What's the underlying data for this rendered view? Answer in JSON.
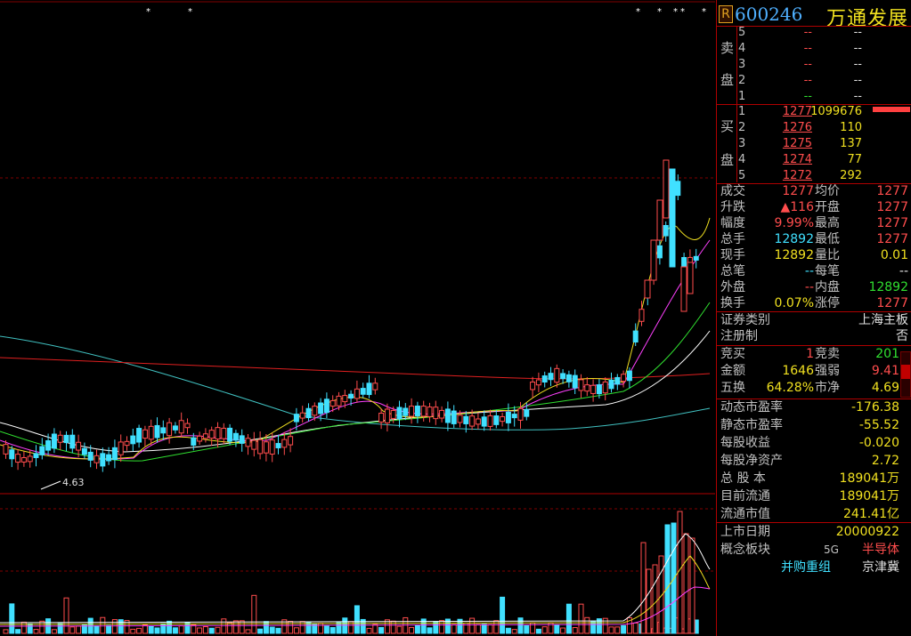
{
  "header": {
    "badge": "R",
    "code": "600246",
    "name": "万通发展"
  },
  "order_book": {
    "sell_label_1": "卖",
    "sell_label_2": "盘",
    "buy_label_1": "买",
    "buy_label_2": "盘",
    "sell": [
      {
        "level": "5",
        "price": "--",
        "volume": "--"
      },
      {
        "level": "4",
        "price": "--",
        "volume": "--"
      },
      {
        "level": "3",
        "price": "--",
        "volume": "--"
      },
      {
        "level": "2",
        "price": "--",
        "volume": "--"
      },
      {
        "level": "1",
        "price": "--",
        "volume": "--"
      }
    ],
    "buy": [
      {
        "level": "1",
        "price": "1277",
        "volume": "1099676"
      },
      {
        "level": "2",
        "price": "1276",
        "volume": "110"
      },
      {
        "level": "3",
        "price": "1275",
        "volume": "137"
      },
      {
        "level": "4",
        "price": "1274",
        "volume": "77"
      },
      {
        "level": "5",
        "price": "1272",
        "volume": "292"
      }
    ]
  },
  "quote": [
    {
      "k1": "成交",
      "v1": "1277",
      "k2": "均价",
      "v2": "1277"
    },
    {
      "k1": "升跌",
      "v1": "▲116",
      "k2": "开盘",
      "v2": "1277"
    },
    {
      "k1": "幅度",
      "v1": "9.99%",
      "k2": "最高",
      "v2": "1277"
    },
    {
      "k1": "总手",
      "v1": "12892",
      "k2": "最低",
      "v2": "1277"
    },
    {
      "k1": "现手",
      "v1": "12892",
      "k2": "量比",
      "v2": "0.01"
    },
    {
      "k1": "总笔",
      "v1": "--",
      "k2": "每笔",
      "v2": "--"
    },
    {
      "k1": "外盘",
      "v1": "--",
      "k2": "内盘",
      "v2": "12892"
    },
    {
      "k1": "换手",
      "v1": "0.07%",
      "k2": "涨停",
      "v2": "1277"
    }
  ],
  "category": {
    "k1": "证券类别",
    "v1": "上海主板",
    "k2": "注册制",
    "v2": "否"
  },
  "auction": [
    {
      "k1": "竞买",
      "v1": "1",
      "k2": "竞卖",
      "v2": "201"
    },
    {
      "k1": "金额",
      "v1": "1646",
      "k2": "强弱",
      "v2": "9.41"
    },
    {
      "k1": "五换",
      "v1": "64.28%",
      "k2": "市净",
      "v2": "4.69"
    }
  ],
  "fundamentals": [
    {
      "k": "动态市盈率",
      "v": "-176.38"
    },
    {
      "k": "静态市盈率",
      "v": "-55.52"
    },
    {
      "k": "每股收益",
      "v": "-0.020"
    },
    {
      "k": "每股净资产",
      "v": "2.72"
    },
    {
      "k": "总 股 本",
      "v": "189041万"
    },
    {
      "k": "目前流通",
      "v": "189041万"
    },
    {
      "k": "流通市值",
      "v": "241.41亿"
    }
  ],
  "listing": {
    "k": "上市日期",
    "v": "20000922"
  },
  "concept": {
    "k": "概念板块",
    "tag1": "5G",
    "tag2": "半导体",
    "tag3": "并购重组",
    "tag4": "京津冀"
  },
  "chart": {
    "low_label": "4.63",
    "circle_icon": "①"
  },
  "colors": {
    "up": "#ff4d4d",
    "down": "#40e0ff",
    "ma5": "#ffffff",
    "ma10": "#f0e020",
    "ma20": "#ff40ff",
    "ma30": "#30e030",
    "ma60": "#40c0c0",
    "ma120": "#e02020"
  }
}
